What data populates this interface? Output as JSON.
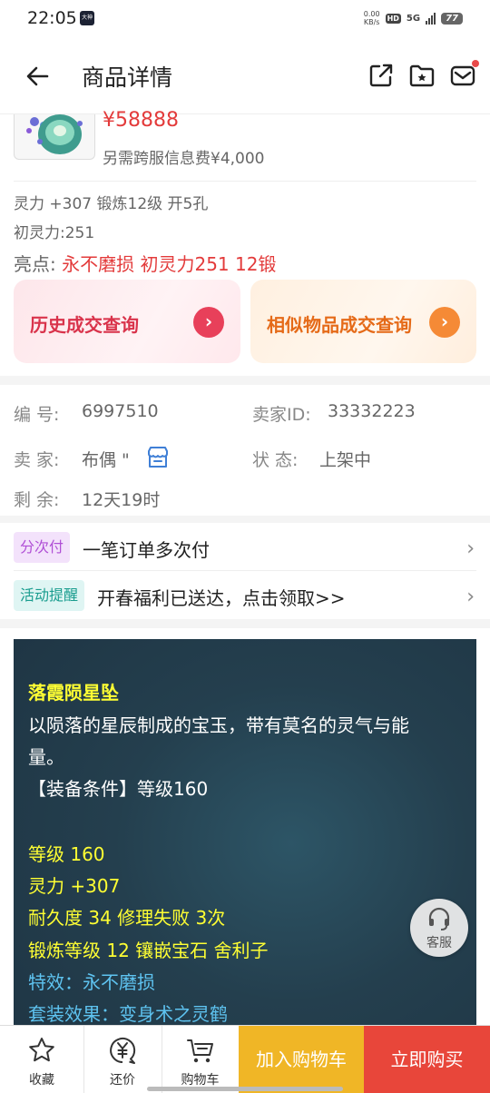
{
  "status_bar": {
    "time": "22:05",
    "app_badge": "大神",
    "net_speed_value": "0.00",
    "net_speed_unit": "KB/s",
    "hd": "HD",
    "network": "5G",
    "battery": "77"
  },
  "nav": {
    "title": "商品详情"
  },
  "item": {
    "price": "¥58888",
    "fee_note": "另需跨服信息费¥4,000",
    "attrs": "灵力 +307 锻炼12级 开5孔",
    "initial_spirit": "初灵力:251",
    "highlight_label": "亮点:",
    "highlight_text": "永不磨损 初灵力251 12锻"
  },
  "query_cards": {
    "history": "历史成交查询",
    "similar": "相似物品成交查询"
  },
  "info": {
    "id_label": "编  号:",
    "id_value": "6997510",
    "seller_id_label": "卖家ID:",
    "seller_id_value": "33332223",
    "seller_label": "卖  家:",
    "seller_value": "布偶 \"",
    "status_label": "状  态:",
    "status_value": "上架中",
    "remaining_label": "剩  余:",
    "remaining_value": "12天19时"
  },
  "promos": [
    {
      "tag": "分次付",
      "text": "一笔订单多次付"
    },
    {
      "tag": "活动提醒",
      "text": "开春福利已送达，点击领取>>"
    }
  ],
  "description": {
    "name": "落霞陨星坠",
    "lore_line1": "以陨落的星辰制成的宝玉，带有莫名的灵气与能",
    "lore_line2": "量。",
    "requirement": "【装备条件】等级160",
    "level": "等级 160",
    "spirit": "灵力 +307",
    "durability": "耐久度 34 修理失败 3次",
    "forge": "锻炼等级 12 镶嵌宝石 舍利子",
    "special": "特效：永不磨损",
    "set_effect": "套装效果：变身术之灵鹤"
  },
  "customer_service": "客服",
  "bottom_bar": {
    "favorite": "收藏",
    "bargain": "还价",
    "cart": "购物车",
    "add_to_cart": "加入购物车",
    "buy_now": "立即购买"
  }
}
